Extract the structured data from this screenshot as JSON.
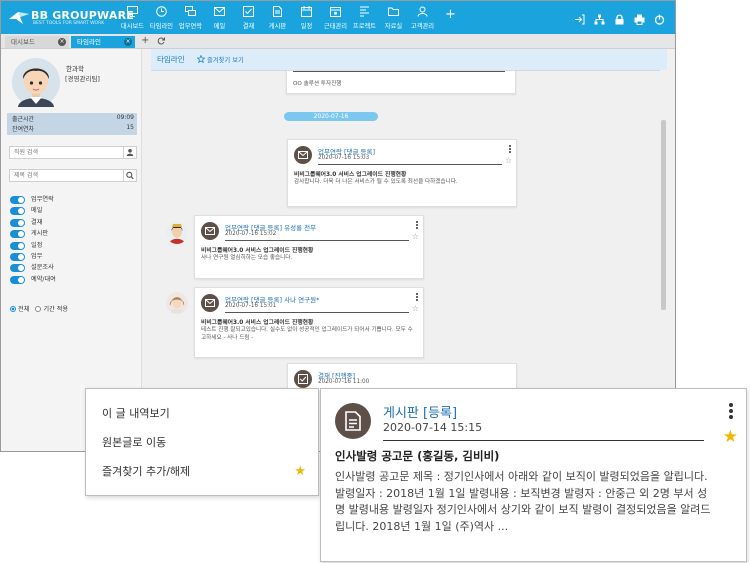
{
  "app": {
    "logo_text": "BB GROUPWARE",
    "logo_sub": "BEST TOOLS FOR SMART WORK"
  },
  "nav": [
    {
      "label": "대시보드",
      "icon": "monitor-icon"
    },
    {
      "label": "타임라인",
      "icon": "clock-icon"
    },
    {
      "label": "업무연락",
      "icon": "messages-icon"
    },
    {
      "label": "메일",
      "icon": "mail-icon"
    },
    {
      "label": "결재",
      "icon": "approval-icon"
    },
    {
      "label": "게시판",
      "icon": "board-icon"
    },
    {
      "label": "일정",
      "icon": "calendar-icon"
    },
    {
      "label": "근태관리",
      "icon": "attendance-icon"
    },
    {
      "label": "프로젝트",
      "icon": "project-icon"
    },
    {
      "label": "자료실",
      "icon": "folder-icon"
    },
    {
      "label": "고객관리",
      "icon": "customer-icon"
    }
  ],
  "tabs": [
    {
      "label": "대시보드"
    },
    {
      "label": "타임라인"
    }
  ],
  "user": {
    "name": "한과학",
    "dept": "[경영관리팀]",
    "work_start_label": "출근시간",
    "work_start_value": "09:09",
    "remaining_label": "잔여연차",
    "remaining_value": "15"
  },
  "search": {
    "person_placeholder": "직원 검색",
    "title_placeholder": "제목 검색"
  },
  "filters": [
    "업무연락",
    "메일",
    "결재",
    "게시판",
    "일정",
    "업무",
    "설문조사",
    "예약/대여"
  ],
  "period": {
    "all_label": "전체",
    "range_label": "기간 적용"
  },
  "timeline": {
    "title": "타임라인",
    "fav_label": "즐겨찾기 보기",
    "prev_card_text": "OO 솔루션 투자진행",
    "date_pill": "2020-07-16",
    "cards": [
      {
        "title": "업무연락 [댓글 등록]",
        "date": "2020-07-16 15:03",
        "subject": "비비그룹웨어3.0 서비스 업그레이드 진행현황",
        "body": "감사합니다. 더욱 더 나은 서비스가 될 수 있도록 최선을 다하겠습니다."
      },
      {
        "title": "업무연락 [댓글 등록] 유성룡 전무",
        "date": "2020-07-16 15:02",
        "subject": "비비그룹웨어3.0 서비스 업그레이드 진행현황",
        "body": "사나 연구원 열심히하는 모습 좋습니다."
      },
      {
        "title": "업무연락 [댓글 등록] 사나 연구원*",
        "date": "2020-07-16 15:01",
        "subject": "비비그룹웨어3.0 서비스 업그레이드 진행현황",
        "body": "테스트 진행 잘되고있습니다. 실수도 없이 성공적인 업그레이드가 되어서 기쁩니다. 모두 수고하세요 - 사나 드림 -"
      },
      {
        "title": "결재 [진행중]",
        "date": "2020-07-16 11:00"
      }
    ]
  },
  "context_menu": {
    "items": [
      "이 글 내역보기",
      "원본글로 이동",
      "즐겨찾기 추가/해제"
    ]
  },
  "zoom_card": {
    "title": "게시판 [등록]",
    "date": "2020-07-14 15:15",
    "subject": "인사발령 공고문 (홍길동, 김비비)",
    "body": "인사발령 공고문 제목 : 정기인사에서 아래와 같이 보직이 발령되었음을 알립니다. 발령일자 : 2018년 1월 1일 발령내용 : 보직변경 발령자 : 안중근 외 2명 부서 성명 발령내용 발령일자 정기인사에서 상기와 같이 보직 발령이 결정되었음을 알려드립니다. 2018년 1월 1일 (주)역사 ..."
  },
  "colors": {
    "header": "#1aa3dd",
    "accent": "#1a6fb0",
    "toggle": "#1a8fd6",
    "star": "#f2b705",
    "icon_circle": "#5e5048"
  }
}
